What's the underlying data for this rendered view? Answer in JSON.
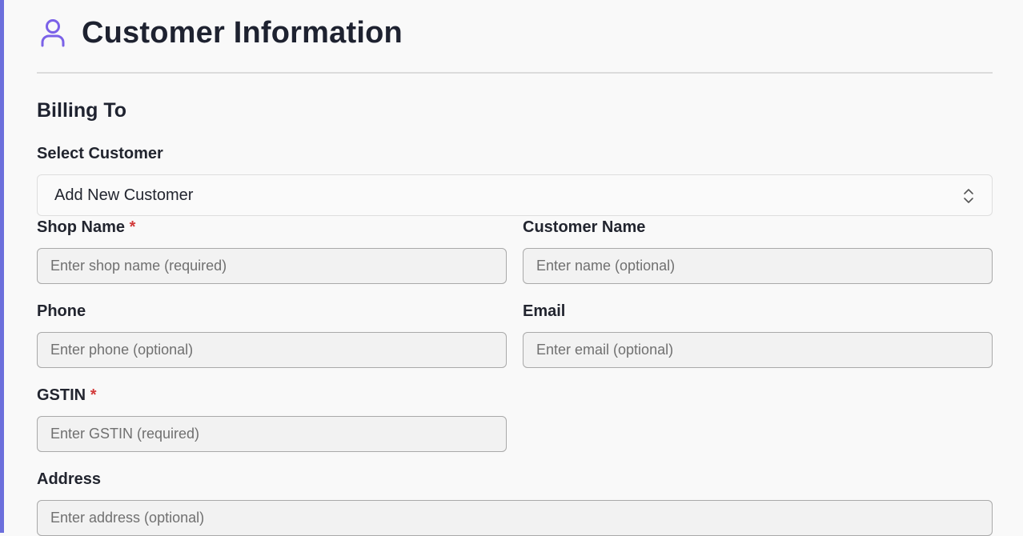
{
  "header": {
    "title": "Customer Information",
    "icon": "user-icon",
    "accent_color": "#6c6fdc"
  },
  "billing": {
    "section_title": "Billing To"
  },
  "select_customer": {
    "label": "Select Customer",
    "value": "Add New Customer"
  },
  "fields": {
    "shop_name": {
      "label": "Shop Name",
      "required_mark": "*",
      "placeholder": "Enter shop name (required)"
    },
    "customer_name": {
      "label": "Customer Name",
      "placeholder": "Enter name (optional)"
    },
    "phone": {
      "label": "Phone",
      "placeholder": "Enter phone (optional)"
    },
    "email": {
      "label": "Email",
      "placeholder": "Enter email (optional)"
    },
    "gstin": {
      "label": "GSTIN",
      "required_mark": "*",
      "placeholder": "Enter GSTIN (required)"
    },
    "address": {
      "label": "Address",
      "placeholder": "Enter address (optional)"
    }
  }
}
